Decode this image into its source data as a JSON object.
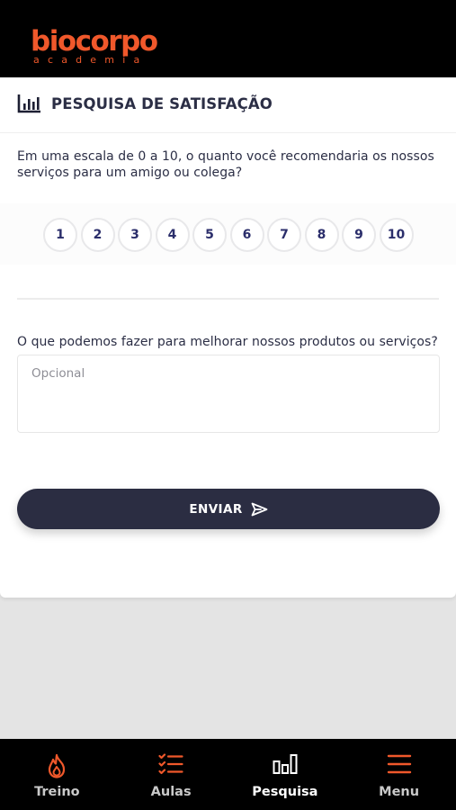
{
  "header": {
    "logo_main": "biocorpo",
    "logo_sub": "academia"
  },
  "survey": {
    "title": "PESQUISA DE SATISFAÇÃO",
    "title_icon": "bar-chart-icon",
    "nps_question": "Em uma escala de 0 a 10, o quanto você recomendaria os nossos serviços para um amigo ou colega?",
    "scale": [
      "1",
      "2",
      "3",
      "4",
      "5",
      "6",
      "7",
      "8",
      "9",
      "10"
    ],
    "improve_question": "O que podemos fazer para melhorar nossos produtos ou serviços?",
    "improve_placeholder": "Opcional",
    "improve_value": "",
    "submit_label": "ENVIAR",
    "submit_icon": "send-icon"
  },
  "nav": {
    "items": [
      {
        "label": "Treino",
        "icon": "flame-icon",
        "active": false
      },
      {
        "label": "Aulas",
        "icon": "checklist-icon",
        "active": false
      },
      {
        "label": "Pesquisa",
        "icon": "bar-chart-icon",
        "active": true
      },
      {
        "label": "Menu",
        "icon": "hamburger-icon",
        "active": false
      }
    ]
  },
  "colors": {
    "brand": "#f0582b",
    "dark": "#2b2d42",
    "nav_bg": "#000000",
    "active": "#ffffff",
    "inactive": "#c9c9c9"
  }
}
